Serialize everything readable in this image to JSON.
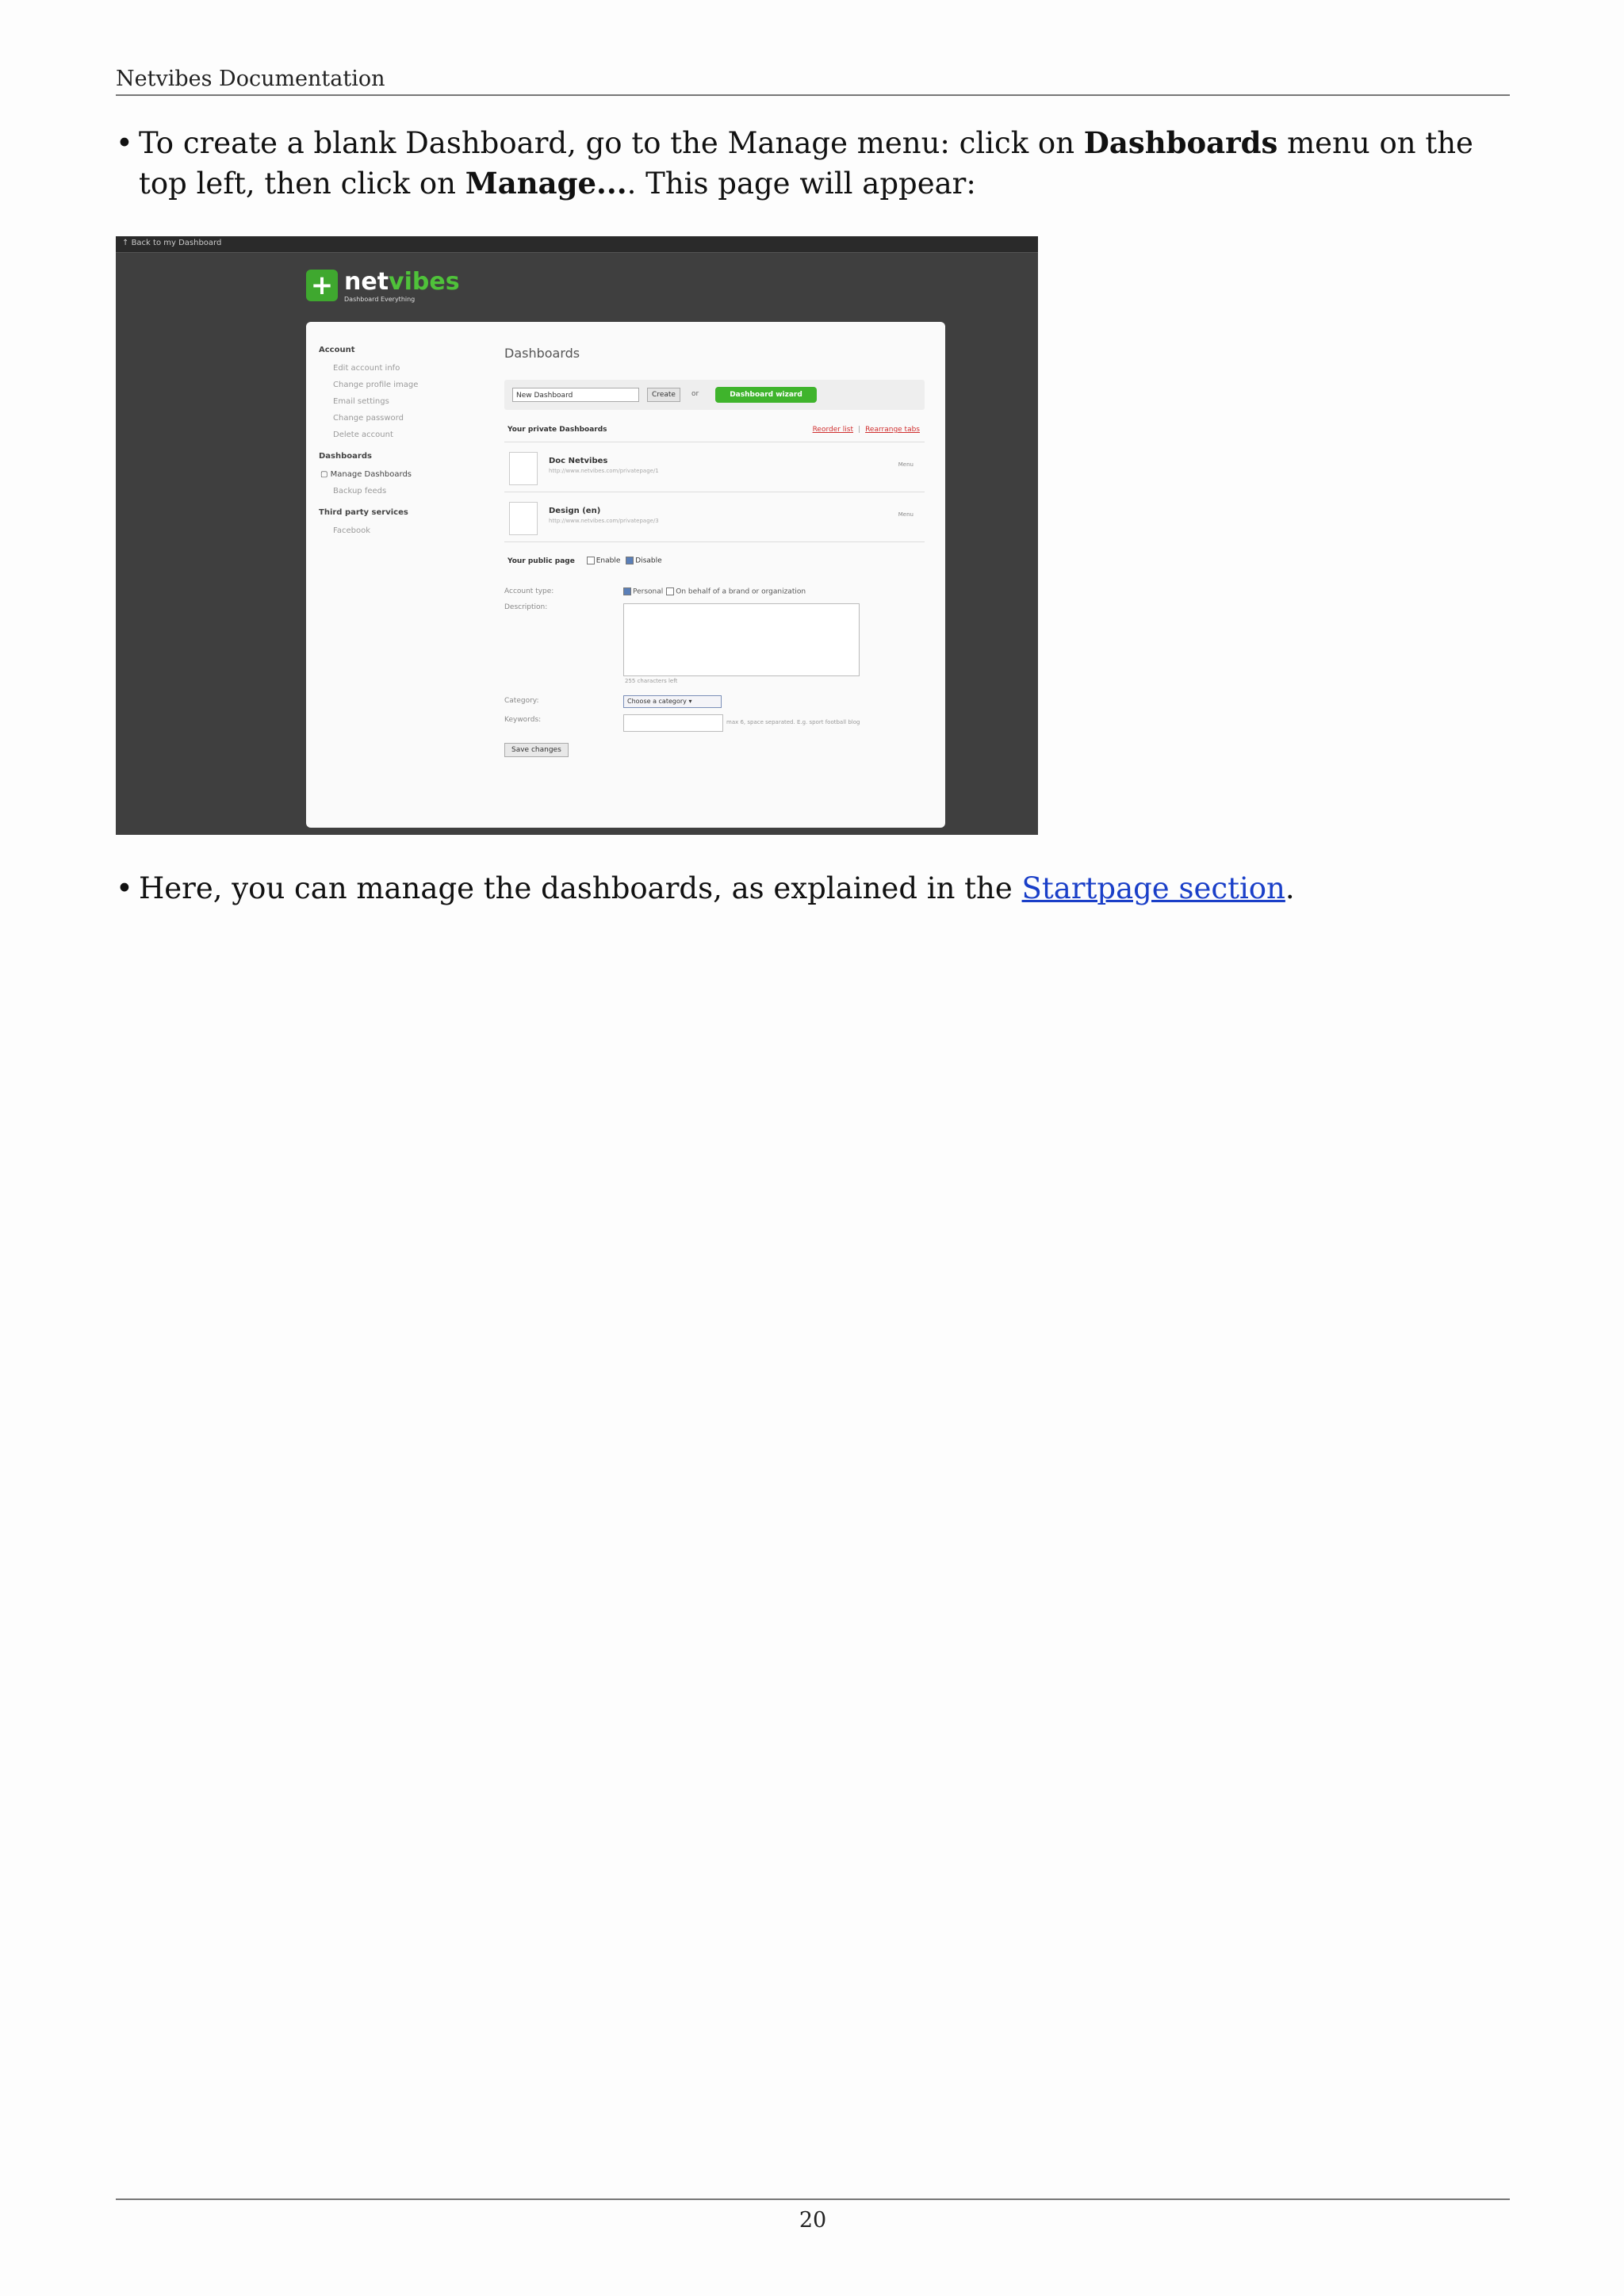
{
  "header": {
    "title": "Netvibes Documentation"
  },
  "bullet1": {
    "text_a": "To create a blank Dashboard, go to the Manage menu: click on ",
    "bold_a": "Dashboards",
    "text_b": " menu on the top left, then click on ",
    "bold_b": "Manage...",
    "text_c": ". This page will appear:"
  },
  "screenshot": {
    "back_link": "Back to my Dashboard",
    "logo": {
      "net": "net",
      "vibes": "vibes",
      "tagline": "Dashboard Everything"
    },
    "sidebar": {
      "account_heading": "Account",
      "account_items": [
        "Edit account info",
        "Change profile image",
        "Email settings",
        "Change password",
        "Delete account"
      ],
      "dashboards_heading": "Dashboards",
      "dashboards_items": [
        "Manage Dashboards",
        "Backup feeds"
      ],
      "third_party_heading": "Third party services",
      "third_party_items": [
        "Facebook"
      ]
    },
    "main": {
      "title": "Dashboards",
      "new_dashboard_value": "New Dashboard",
      "create_label": "Create",
      "or_label": "or",
      "wizard_label": "Dashboard wizard",
      "private_heading": "Your private Dashboards",
      "reorder_link": "Reorder list",
      "rearrange_link": "Rearrange tabs",
      "dashboards": [
        {
          "name": "Doc Netvibes",
          "url": "http://www.netvibes.com/privatepage/1",
          "menu": "Menu"
        },
        {
          "name": "Design (en)",
          "url": "http://www.netvibes.com/privatepage/3",
          "menu": "Menu"
        }
      ],
      "public_label": "Your public page",
      "enable_label": "Enable",
      "disable_label": "Disable",
      "account_type_label": "Account type:",
      "personal_label": "Personal",
      "brand_label": "On behalf of a brand or organization",
      "description_label": "Description:",
      "chars_left": "255 characters left",
      "category_label": "Category:",
      "category_value": "Choose a category",
      "keywords_label": "Keywords:",
      "keywords_hint": "max 6, space separated. E.g. sport football blog",
      "save_label": "Save changes"
    }
  },
  "bullet2": {
    "text_a": "Here, you can manage the dashboards, as explained in the ",
    "link": "Startpage section",
    "text_b": "."
  },
  "footer": {
    "page_number": "20"
  }
}
